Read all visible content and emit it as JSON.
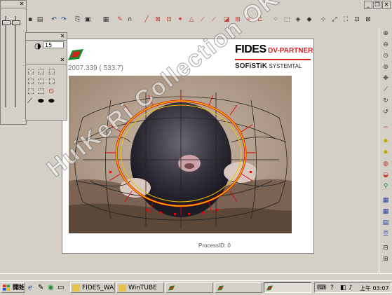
{
  "window": {
    "minimize_icon": "minimize-icon",
    "restore_icon": "restore-icon",
    "close_icon": "close-icon"
  },
  "document": {
    "brand_primary": "FIDES",
    "brand_secondary": "DV-PARTNER",
    "partner": "SOFiSTiK",
    "partner_suffix": "SYSTEMTAL",
    "coordinates": "2007.339 ( 533.7)",
    "process_id": "ProcessID: 0"
  },
  "watermark": "HuiKeRi Collection OK",
  "palette": {
    "input_value": "15"
  },
  "taskbar": {
    "start_label": "開始",
    "tasks": [
      "FIDES_WA...",
      "WinTUBE",
      "",
      "",
      ""
    ],
    "clock": "上午 03:07"
  },
  "colors": {
    "window_bg": "#d4d0c8",
    "accent_green": "#1a8a2a",
    "accent_red": "#d41f1f",
    "mesh_yellow": "#f2c400",
    "mesh_red": "#e00000"
  }
}
